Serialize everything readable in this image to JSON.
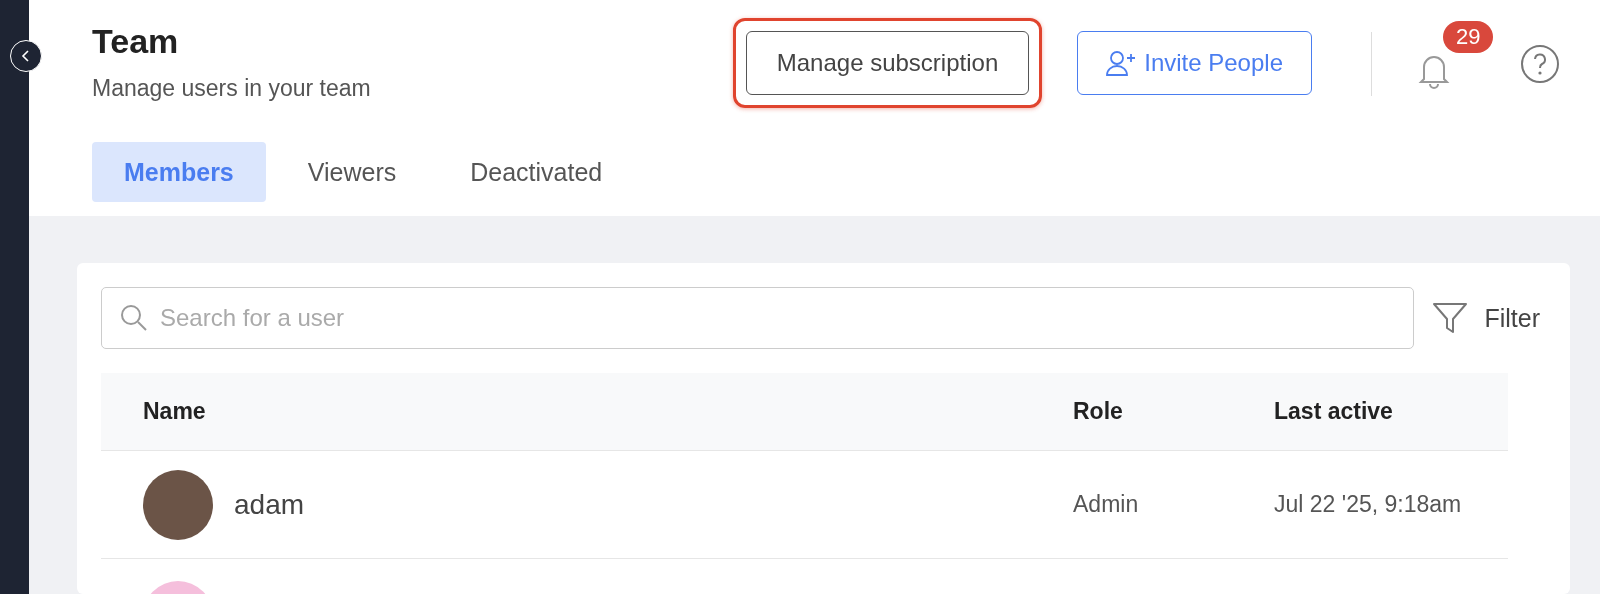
{
  "header": {
    "title": "Team",
    "subtitle": "Manage users in your team",
    "buttons": [
      {
        "kind": "outline",
        "label": "Manage subscription",
        "highlighted": true
      },
      {
        "kind": "primary",
        "label": "Invite People",
        "highlighted": false
      }
    ],
    "notifications": {
      "count": "29"
    }
  },
  "tabs": [
    {
      "label": "Members",
      "selected": true
    },
    {
      "label": "Viewers",
      "selected": false
    },
    {
      "label": "Deactivated",
      "selected": false
    }
  ],
  "search": {
    "placeholder": "Search for a user"
  },
  "filter": {
    "label": "Filter"
  },
  "table": {
    "columns": [
      "Name",
      "Role",
      "Last active"
    ],
    "rows": [
      {
        "kind": "photo",
        "name": "adam",
        "role": "Admin",
        "last_active": "Jul 22 '25, 9:18am"
      },
      {
        "kind": "partial"
      }
    ]
  }
}
